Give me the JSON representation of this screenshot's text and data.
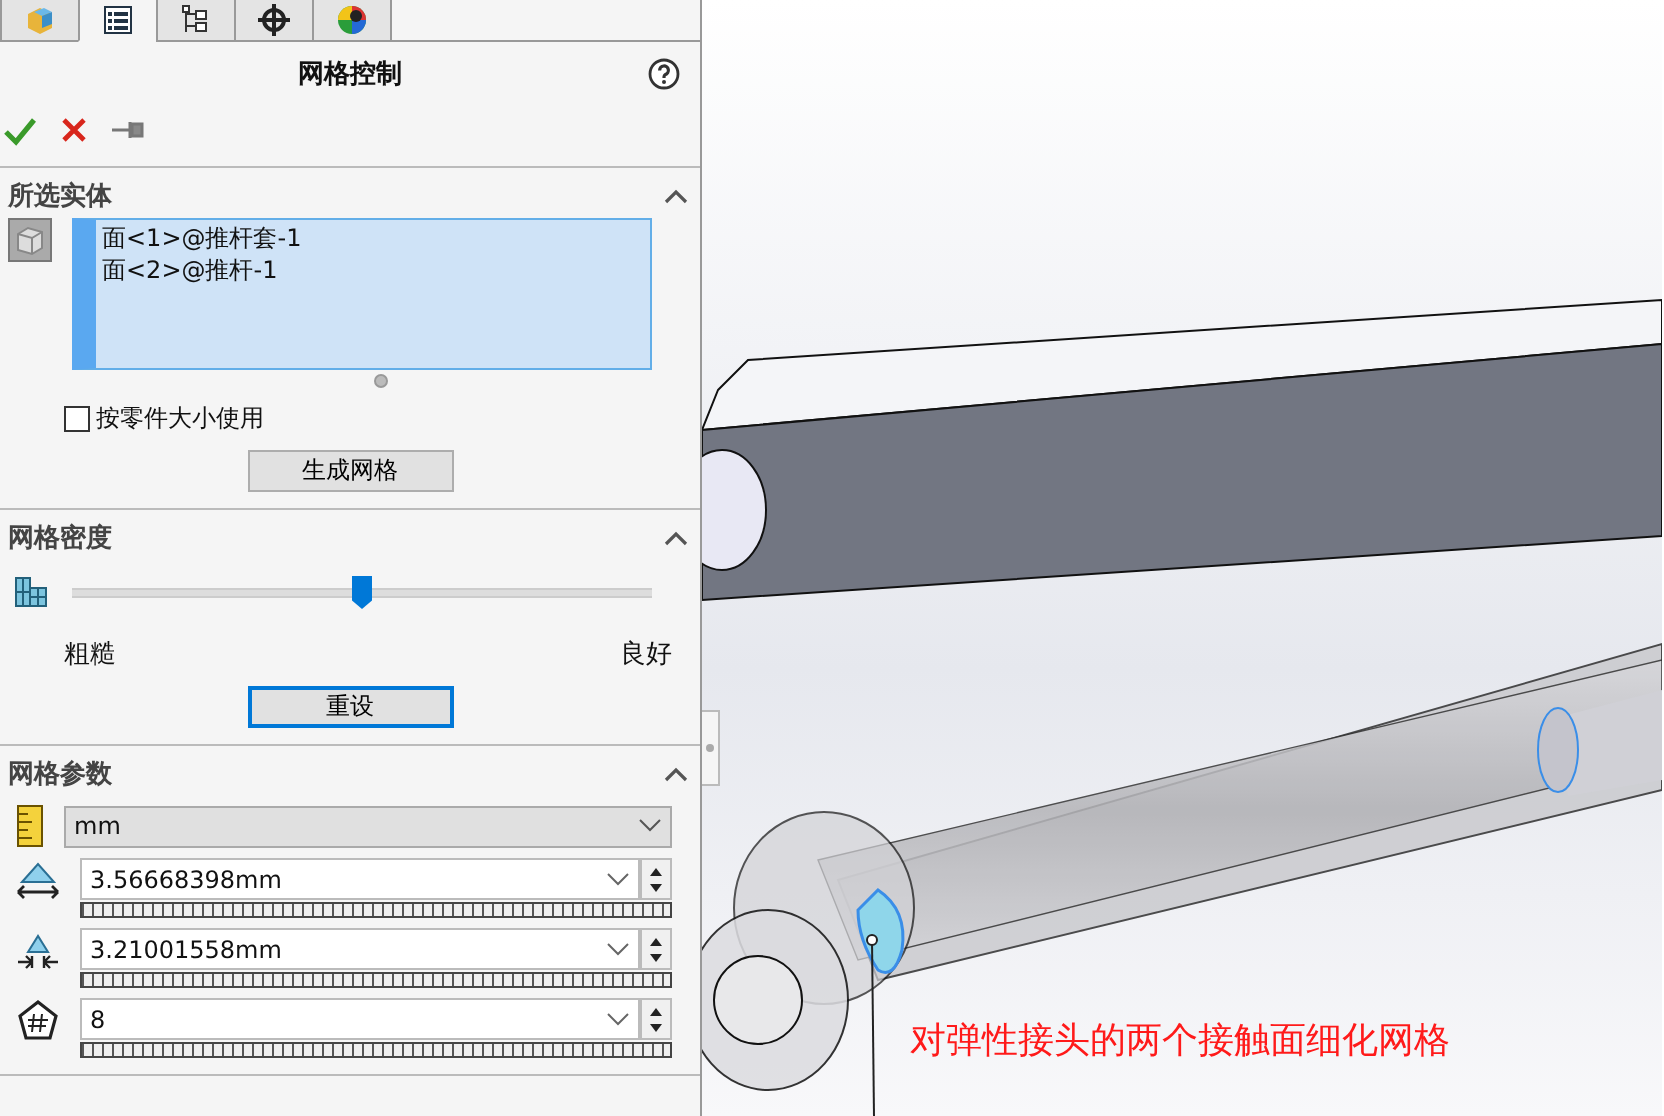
{
  "tabs": [
    {
      "selected": false
    },
    {
      "selected": true
    },
    {
      "selected": false
    },
    {
      "selected": false
    },
    {
      "selected": false
    }
  ],
  "title": "网格控制",
  "sections": [
    {
      "kind": "selection",
      "title": "所选实体",
      "expanded": true,
      "items": [
        "面<1>@推杆套-1",
        "面<2>@推杆-1"
      ],
      "checkbox": {
        "label": "按零件大小使用",
        "checked": false
      },
      "button": {
        "label": "生成网格",
        "focused": false
      }
    },
    {
      "kind": "density",
      "title": "网格密度",
      "expanded": true,
      "level": 0.5,
      "min_label": "粗糙",
      "max_label": "良好",
      "button": {
        "label": "重设",
        "focused": true
      }
    },
    {
      "kind": "parameters",
      "title": "网格参数",
      "expanded": true,
      "unit": "mm",
      "fields": [
        {
          "kind": "size",
          "value": "3.56668398mm"
        },
        {
          "kind": "ratio",
          "value": "3.21001558mm"
        },
        {
          "kind": "count",
          "value": "8"
        }
      ]
    }
  ],
  "annotation": "对弹性接头的两个接触面细化网格"
}
